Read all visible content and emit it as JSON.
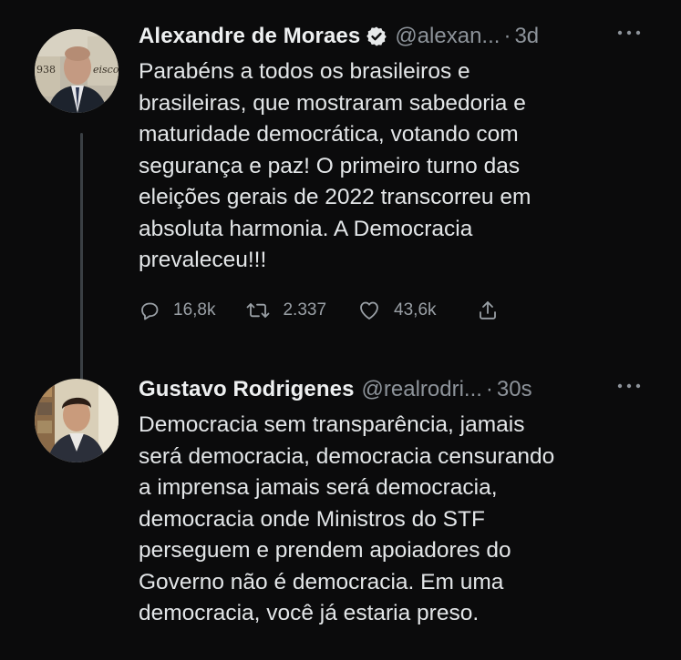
{
  "tweets": [
    {
      "author": "Alexandre de Moraes",
      "verified": true,
      "handle": "@alexan...",
      "separator": "·",
      "time": "3d",
      "text_lines": [
        "Parabéns a todos os brasileiros e",
        "brasileiras, que mostraram sabedoria e",
        "maturidade democrática, votando com",
        "segurança e paz! O primeiro turno das",
        "eleições gerais de 2022 transcorreu em",
        "absoluta harmonia. A Democracia",
        "prevaleceu!!!"
      ],
      "replies": "16,8k",
      "retweets": "2.337",
      "likes": "43,6k",
      "avatar_caption_1": "938",
      "avatar_caption_2": "eisco"
    },
    {
      "author": "Gustavo Rodrigenes",
      "verified": false,
      "handle": "@realrodri...",
      "separator": "·",
      "time": "30s",
      "text_lines": [
        "Democracia sem transparência, jamais",
        "será democracia, democracia censurando",
        "a imprensa jamais será democracia,",
        "democracia onde Ministros do STF",
        "perseguem e prendem apoiadores do",
        "Governo não é democracia. Em uma",
        "democracia, você já estaria preso."
      ]
    }
  ],
  "icons": {
    "verified": "verified-badge-icon",
    "more": "more-horizontal-icon",
    "reply": "reply-icon",
    "retweet": "retweet-icon",
    "like": "like-icon",
    "share": "share-icon"
  },
  "colors": {
    "background": "#0b0b0c",
    "primary_text": "#e7e9ea",
    "secondary_text": "#8d939a",
    "thread_line": "#3a3f44"
  }
}
